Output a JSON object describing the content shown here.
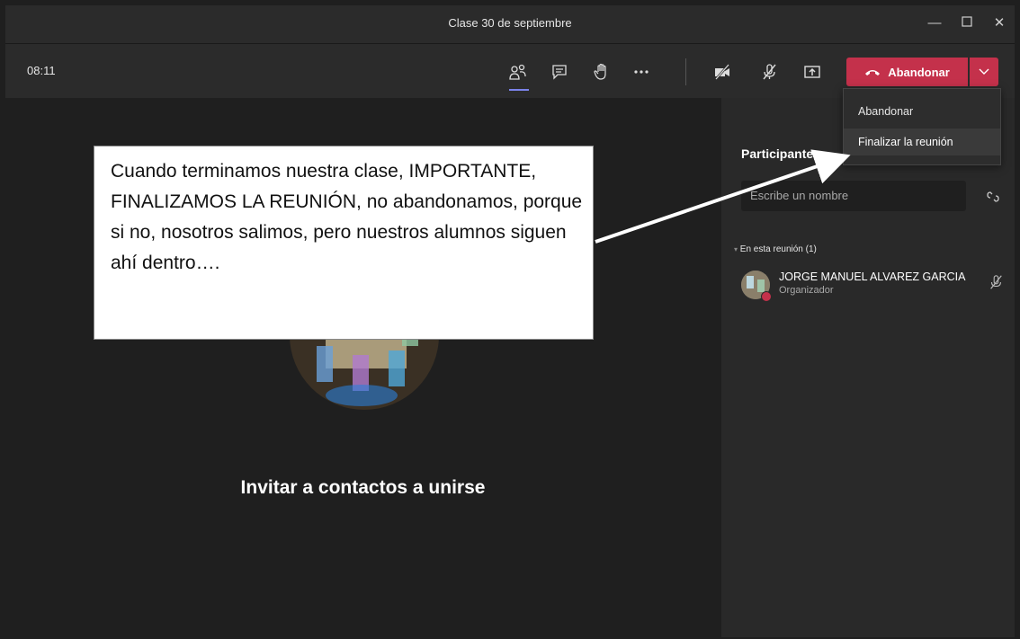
{
  "window": {
    "title": "Clase 30 de septiembre"
  },
  "toolbar": {
    "time": "08:11",
    "leave_label": "Abandonar"
  },
  "leave_menu": {
    "items": [
      "Abandonar",
      "Finalizar la reunión"
    ]
  },
  "sidebar": {
    "title": "Participantes",
    "search_placeholder": "Escribe un nombre",
    "section_label": "En esta reunión (1)",
    "participant": {
      "name": "JORGE MANUEL ALVAREZ GARCIA",
      "role": "Organizador"
    }
  },
  "stage": {
    "invite_text": "Invitar a contactos a unirse"
  },
  "callout": {
    "text": "Cuando terminamos nuestra clase, IMPORTANTE, FINALIZAMOS LA REUNIÓN, no abandonamos, porque si no, nosotros salimos, pero nuestros alumnos siguen ahí dentro…."
  },
  "colors": {
    "accent": "#7b83eb",
    "leave": "#c4314b",
    "background": "#1f1f1f"
  }
}
